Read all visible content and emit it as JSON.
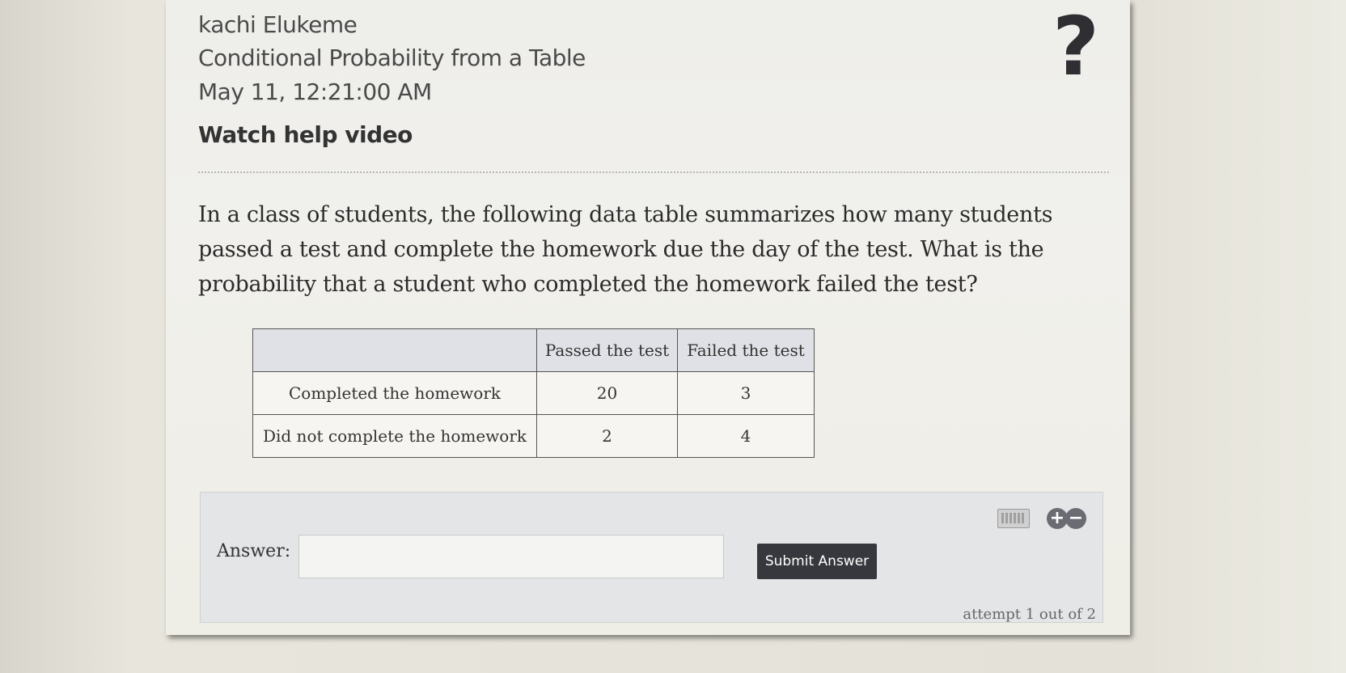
{
  "header": {
    "student_name": "kachi Elukeme",
    "assignment_title": "Conditional Probability from a Table",
    "timestamp": "May 11, 12:21:00 AM",
    "help_video_link": "Watch help video",
    "help_icon": "question-mark-icon"
  },
  "question": {
    "text": "In a class of students, the following data table summarizes how many students passed a test and complete the homework due the day of the test. What is the probability that a student who completed the homework failed the test?"
  },
  "table": {
    "columns": [
      "",
      "Passed the test",
      "Failed the test"
    ],
    "rows": [
      {
        "label": "Completed the homework",
        "passed": "20",
        "failed": "3"
      },
      {
        "label": "Did not complete the homework",
        "passed": "2",
        "failed": "4"
      }
    ]
  },
  "answer_panel": {
    "label": "Answer:",
    "input_value": "",
    "submit_label": "Submit Answer",
    "attempt_text": "attempt 1 out of 2",
    "icons": [
      "keyboard-icon",
      "plus-icon",
      "minus-icon"
    ]
  }
}
